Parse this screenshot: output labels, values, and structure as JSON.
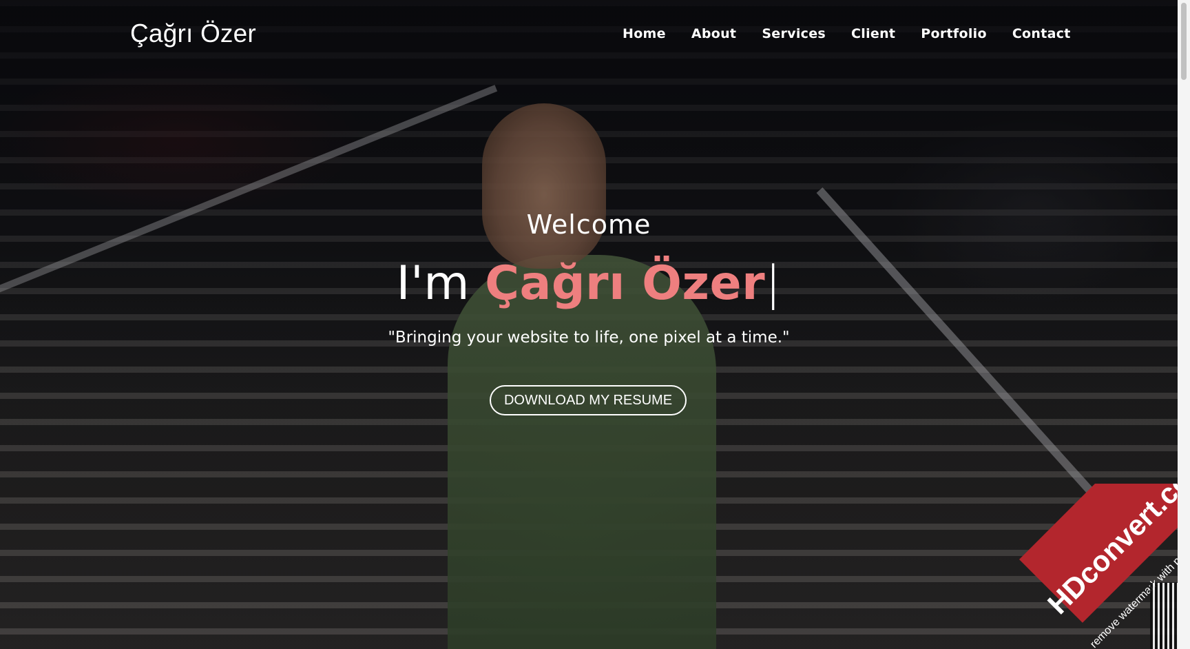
{
  "header": {
    "logo": "Çağrı Özer",
    "nav": [
      {
        "label": "Home"
      },
      {
        "label": "About"
      },
      {
        "label": "Services"
      },
      {
        "label": "Client"
      },
      {
        "label": "Portfolio"
      },
      {
        "label": "Contact"
      }
    ]
  },
  "hero": {
    "welcome": "Welcome",
    "intro": "I'm ",
    "name": "Çağrı Özer",
    "cursor": "|",
    "tagline": "\"Bringing your website to life, one pixel at a time.\"",
    "resume_button": "DOWNLOAD MY RESUME",
    "accent_color": "#ee7f7f"
  },
  "watermark": {
    "brand": "HDconvert.co",
    "sub": "remove watermark with p",
    "color": "#b3262d"
  }
}
